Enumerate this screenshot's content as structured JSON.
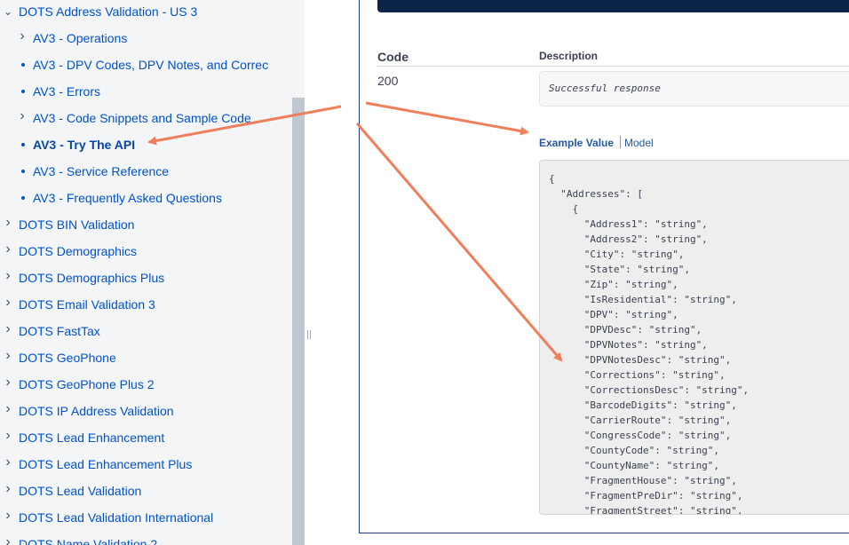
{
  "sidebar": {
    "items": [
      {
        "label": "DOTS Address Validation - US 3",
        "marker": "chevron-down",
        "level": 0
      },
      {
        "label": "AV3 - Operations",
        "marker": "chevron-right",
        "level": 1
      },
      {
        "label": "AV3 - DPV Codes, DPV Notes, and Correc",
        "marker": "bullet",
        "level": 1
      },
      {
        "label": "AV3 - Errors",
        "marker": "bullet",
        "level": 1
      },
      {
        "label": "AV3 - Code Snippets and Sample Code",
        "marker": "chevron-right",
        "level": 1
      },
      {
        "label": "AV3 - Try The API",
        "marker": "bullet",
        "level": 1,
        "active": true
      },
      {
        "label": "AV3 - Service Reference",
        "marker": "bullet",
        "level": 1
      },
      {
        "label": "AV3 - Frequently Asked Questions",
        "marker": "bullet",
        "level": 1
      },
      {
        "label": "DOTS BIN Validation",
        "marker": "chevron-right",
        "level": 0
      },
      {
        "label": "DOTS Demographics",
        "marker": "chevron-right",
        "level": 0
      },
      {
        "label": "DOTS Demographics Plus",
        "marker": "chevron-right",
        "level": 0
      },
      {
        "label": "DOTS Email Validation 3",
        "marker": "chevron-right",
        "level": 0
      },
      {
        "label": "DOTS FastTax",
        "marker": "chevron-right",
        "level": 0
      },
      {
        "label": "DOTS GeoPhone",
        "marker": "chevron-right",
        "level": 0
      },
      {
        "label": "DOTS GeoPhone Plus 2",
        "marker": "chevron-right",
        "level": 0
      },
      {
        "label": "DOTS IP Address Validation",
        "marker": "chevron-right",
        "level": 0
      },
      {
        "label": "DOTS Lead Enhancement",
        "marker": "chevron-right",
        "level": 0
      },
      {
        "label": "DOTS Lead Enhancement Plus",
        "marker": "chevron-right",
        "level": 0
      },
      {
        "label": "DOTS Lead Validation",
        "marker": "chevron-right",
        "level": 0
      },
      {
        "label": "DOTS Lead Validation International",
        "marker": "chevron-right",
        "level": 0
      },
      {
        "label": "DOTS Name Validation 2",
        "marker": "chevron-right",
        "level": 0
      }
    ]
  },
  "responses": {
    "code_header": "Code",
    "description_header": "Description",
    "code": "200",
    "description": "Successful response",
    "tabs": {
      "example": "Example Value",
      "model": "Model"
    },
    "example_lines": [
      "{",
      "  \"Addresses\": [",
      "    {",
      "      \"Address1\": \"string\",",
      "      \"Address2\": \"string\",",
      "      \"City\": \"string\",",
      "      \"State\": \"string\",",
      "      \"Zip\": \"string\",",
      "      \"IsResidential\": \"string\",",
      "      \"DPV\": \"string\",",
      "      \"DPVDesc\": \"string\",",
      "      \"DPVNotes\": \"string\",",
      "      \"DPVNotesDesc\": \"string\",",
      "      \"Corrections\": \"string\",",
      "      \"CorrectionsDesc\": \"string\",",
      "      \"BarcodeDigits\": \"string\",",
      "      \"CarrierRoute\": \"string\",",
      "      \"CongressCode\": \"string\",",
      "      \"CountyCode\": \"string\",",
      "      \"CountyName\": \"string\",",
      "      \"FragmentHouse\": \"string\",",
      "      \"FragmentPreDir\": \"string\",",
      "      \"FragmentStreet\": \"string\","
    ]
  },
  "colors": {
    "link": "#0052cc",
    "annotation_arrow": "#ef7f5a",
    "execute_button": "#0b2447"
  }
}
